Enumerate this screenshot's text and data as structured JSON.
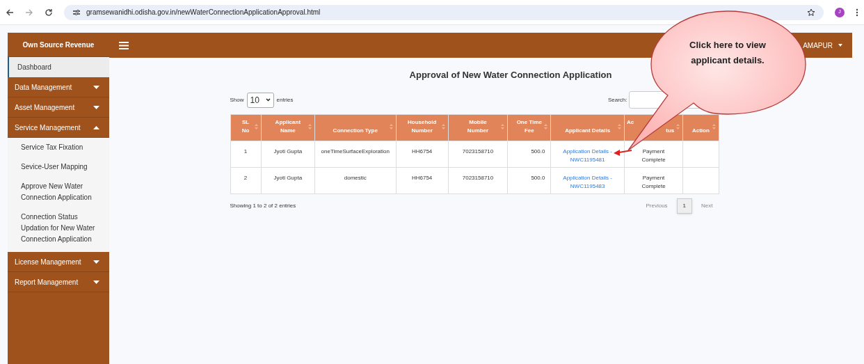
{
  "browser": {
    "url": "gramsewanidhi.odisha.gov.in/newWaterConnectionApplicationApproval.html",
    "profile_initial": "J"
  },
  "sidebar": {
    "title": "Own Source Revenue",
    "items": [
      {
        "label": "Dashboard",
        "kind": "link",
        "selected": true
      },
      {
        "label": "Data Management",
        "kind": "group",
        "expanded": false
      },
      {
        "label": "Asset Management",
        "kind": "group",
        "expanded": false
      },
      {
        "label": "Service Management",
        "kind": "group",
        "expanded": true,
        "children": [
          {
            "label": "Service Tax Fixation"
          },
          {
            "label": "Sevice-User Mapping"
          },
          {
            "label": "Approve New Water Connection Application"
          },
          {
            "label": "Connection Status Updation for New Water Connection Application"
          }
        ]
      },
      {
        "label": "License Management",
        "kind": "group",
        "expanded": false
      },
      {
        "label": "Report Management",
        "kind": "group",
        "expanded": false
      }
    ]
  },
  "topbar": {
    "user": "AMAPUR"
  },
  "page_title": "Approval of New Water Connection Application",
  "length_menu": {
    "before": "Show",
    "value": "10",
    "after": "entries"
  },
  "search": {
    "label": "Search:"
  },
  "table": {
    "columns": [
      {
        "label": "SL No"
      },
      {
        "label": "Applicant Name"
      },
      {
        "label": "Connection Type"
      },
      {
        "label": "Household Number"
      },
      {
        "label": "Mobile Number"
      },
      {
        "label": "One Time Fee"
      },
      {
        "label": "Applicant Details"
      },
      {
        "label": "Ac",
        "label_part_2": "tus"
      },
      {
        "label": "Action"
      }
    ],
    "rows": [
      [
        "1",
        "Jyoti Gupta",
        "oneTimeSurfaceExploration",
        "HH6754",
        "7023158710",
        "500.0",
        "Application Details - NWC1195481",
        "Payment Complete",
        ""
      ],
      [
        "2",
        "Jyoti Gupta",
        "domestic",
        "HH6754",
        "7023158710",
        "500.0",
        "Application Details - NWC1195483",
        "Payment Complete",
        ""
      ]
    ]
  },
  "info": "Showing 1 to 2 of 2 entries",
  "pagination": [
    {
      "label": "Previous",
      "kind": "nav",
      "selected": false
    },
    {
      "label": "1",
      "kind": "page",
      "selected": true
    },
    {
      "label": "Next",
      "kind": "nav",
      "selected": false
    }
  ],
  "callout": {
    "text": "Click here to view applicant details."
  }
}
